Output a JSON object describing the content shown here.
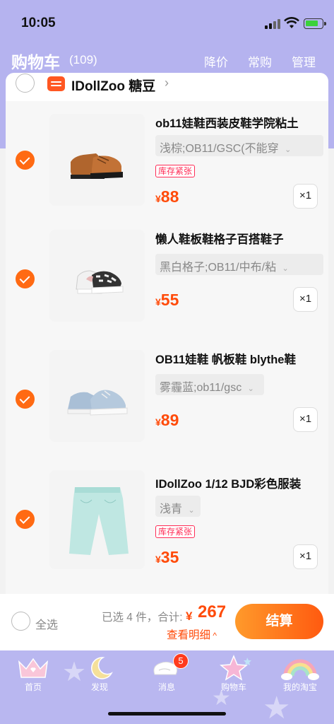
{
  "status": {
    "time": "10:05"
  },
  "header": {
    "title": "购物车",
    "count": "(109)",
    "actions": [
      "降价",
      "常购",
      "管理"
    ]
  },
  "shop": {
    "name": "IDollZoo 糖豆",
    "chevron": "›"
  },
  "items": [
    {
      "title": "ob11娃鞋西装皮鞋学院粘土",
      "sku": "浅棕;OB11/GSC(不能穿",
      "stock": "库存紧张",
      "yen": "¥",
      "price": "88",
      "qty": "×1",
      "checked": true,
      "thumb_icon": "brown-leather-shoes-image"
    },
    {
      "title": "懒人鞋板鞋格子百搭鞋子",
      "sku": "黑白格子;OB11/中布/粘",
      "stock": "",
      "yen": "¥",
      "price": "55",
      "qty": "×1",
      "checked": true,
      "thumb_icon": "checkered-slip-on-shoes-image"
    },
    {
      "title": "OB11娃鞋 帆板鞋 blythe鞋",
      "sku": "雾霾蓝;ob11/gsc",
      "stock": "",
      "yen": "¥",
      "price": "89",
      "qty": "×1",
      "checked": true,
      "thumb_icon": "blue-canvas-shoes-image"
    },
    {
      "title": "IDollZoo 1/12 BJD彩色服装",
      "sku": "浅青",
      "stock": "库存紧张",
      "yen": "¥",
      "price": "35",
      "qty": "×1",
      "checked": true,
      "thumb_icon": "mint-pants-image"
    }
  ],
  "summary": {
    "select_all": "全选",
    "selected_info": "已选 4 件，合计:",
    "total_yen": "¥",
    "total": "267",
    "detail": "查看明细",
    "checkout": "结算"
  },
  "tabbar": {
    "tabs": [
      {
        "label": "首页",
        "icon": "crown-icon"
      },
      {
        "label": "发现",
        "icon": "moon-icon"
      },
      {
        "label": "消息",
        "icon": "wing-icon"
      },
      {
        "label": "购物车",
        "icon": "star-icon"
      },
      {
        "label": "我的淘宝",
        "icon": "rainbow-icon"
      }
    ],
    "message_badge": "5"
  },
  "colors": {
    "accent": "#ff4b0a",
    "header_bg": "#b5b3ef",
    "checkout_gradient": [
      "#ff9a2b",
      "#ff5a10"
    ]
  }
}
